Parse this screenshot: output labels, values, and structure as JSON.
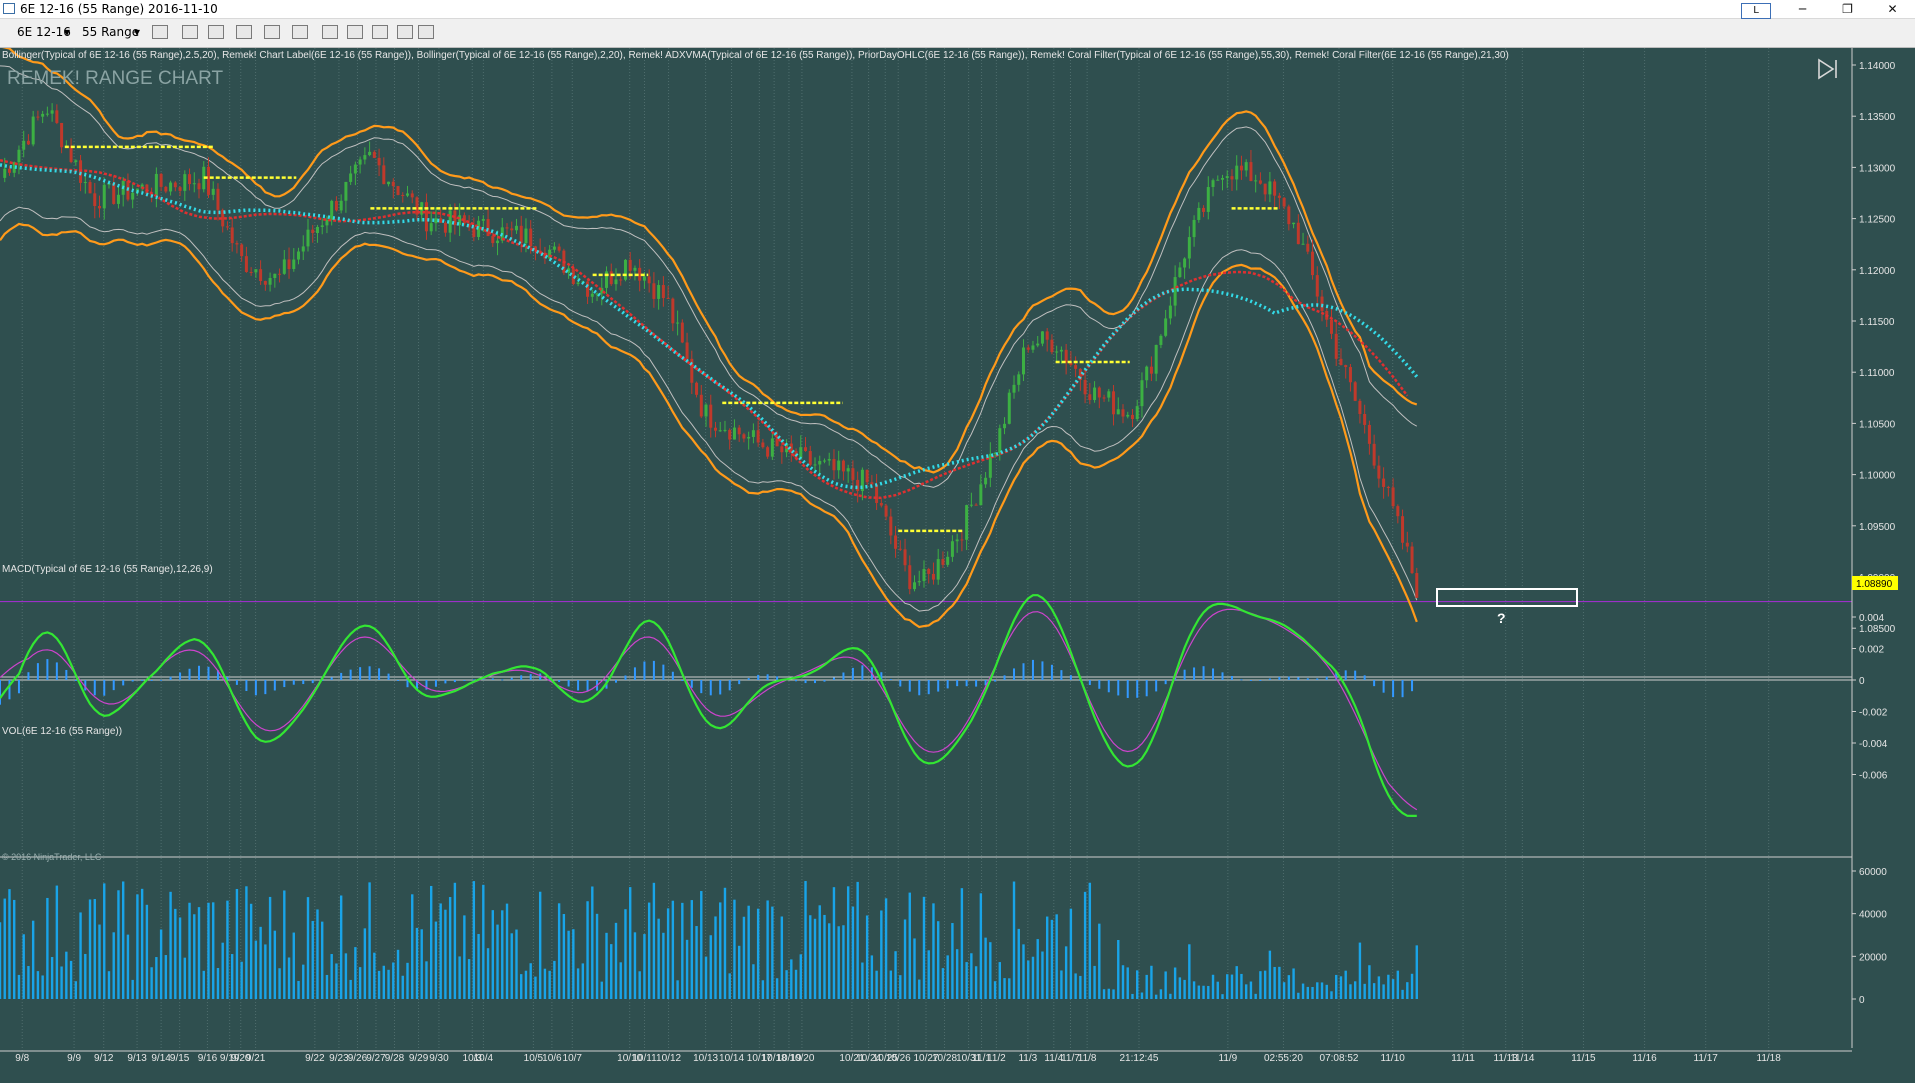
{
  "window": {
    "title": "6E 12-16 (55 Range)  2016-11-10",
    "l_button": "L",
    "minimize": "─",
    "maximize": "❐",
    "close": "✕"
  },
  "toolbar": {
    "instrument": "6E 12-16",
    "period": "55 Range"
  },
  "price_panel": {
    "indicators_label": "Bollinger(Typical of 6E 12-16 (55 Range),2.5,20), Remek! Chart Label(6E 12-16 (55 Range)), Bollinger(Typical of 6E 12-16 (55 Range),2,20), Remek! ADXVMA(Typical of 6E 12-16 (55 Range)), PriorDayOHLC(6E 12-16 (55 Range)), Remek! Coral Filter(Typical of 6E 12-16 (55 Range),55,30), Remek! Coral Filter(6E 12-16 (55 Range),21,30)",
    "watermark": "REMEK! RANGE CHART",
    "y_ticks": [
      "1.14000",
      "1.13500",
      "1.13000",
      "1.12500",
      "1.12000",
      "1.11500",
      "1.11000",
      "1.10500",
      "1.10000",
      "1.09500",
      "1.09000",
      "1.08500"
    ],
    "last_price": "1.08890",
    "question_mark": "?"
  },
  "macd_panel": {
    "label": "MACD(Typical of 6E 12-16 (55 Range),12,26,9)",
    "y_ticks": [
      "0.004",
      "0.002",
      "0",
      "-0.002",
      "-0.004",
      "-0.006"
    ]
  },
  "vol_panel": {
    "label": "VOL(6E 12-16 (55 Range))",
    "y_ticks": [
      "60000",
      "40000",
      "20000",
      "0"
    ],
    "copyright": "© 2016 NinjaTrader, LLC"
  },
  "x_axis": [
    {
      "label": "9/8",
      "anchor": 0.012
    },
    {
      "label": "9/9",
      "anchor": 0.04
    },
    {
      "label": "9/12",
      "anchor": 0.056
    },
    {
      "label": "9/13",
      "anchor": 0.074
    },
    {
      "label": "9/14",
      "anchor": 0.087
    },
    {
      "label": "9/15",
      "anchor": 0.097
    },
    {
      "label": "9/16",
      "anchor": 0.112
    },
    {
      "label": "9/19",
      "anchor": 0.124
    },
    {
      "label": "9/20",
      "anchor": 0.13
    },
    {
      "label": "9/21",
      "anchor": 0.138
    },
    {
      "label": "9/22",
      "anchor": 0.17
    },
    {
      "label": "9/23",
      "anchor": 0.183
    },
    {
      "label": "9/26",
      "anchor": 0.193
    },
    {
      "label": "9/27",
      "anchor": 0.203
    },
    {
      "label": "9/28",
      "anchor": 0.213
    },
    {
      "label": "9/29",
      "anchor": 0.226
    },
    {
      "label": "9/30",
      "anchor": 0.237
    },
    {
      "label": "10/3",
      "anchor": 0.255
    },
    {
      "label": "10/4",
      "anchor": 0.261
    },
    {
      "label": "10/5",
      "anchor": 0.288
    },
    {
      "label": "10/6",
      "anchor": 0.298
    },
    {
      "label": "10/7",
      "anchor": 0.309
    },
    {
      "label": "10/10",
      "anchor": 0.34
    },
    {
      "label": "10/11",
      "anchor": 0.348
    },
    {
      "label": "10/12",
      "anchor": 0.361
    },
    {
      "label": "10/13",
      "anchor": 0.381
    },
    {
      "label": "10/14",
      "anchor": 0.395
    },
    {
      "label": "10/17",
      "anchor": 0.41
    },
    {
      "label": "10/18",
      "anchor": 0.418
    },
    {
      "label": "10/19",
      "anchor": 0.426
    },
    {
      "label": "10/20",
      "anchor": 0.433
    },
    {
      "label": "10/21",
      "anchor": 0.46
    },
    {
      "label": "10/24",
      "anchor": 0.469
    },
    {
      "label": "10/25",
      "anchor": 0.478
    },
    {
      "label": "10/26",
      "anchor": 0.485
    },
    {
      "label": "10/27",
      "anchor": 0.5
    },
    {
      "label": "10/28",
      "anchor": 0.51
    },
    {
      "label": "10/31",
      "anchor": 0.523
    },
    {
      "label": "11/1",
      "anchor": 0.53
    },
    {
      "label": "11/2",
      "anchor": 0.538
    },
    {
      "label": "11/3",
      "anchor": 0.555
    },
    {
      "label": "11/4",
      "anchor": 0.569
    },
    {
      "label": "11/7",
      "anchor": 0.578
    },
    {
      "label": "11/8",
      "anchor": 0.587
    },
    {
      "label": "21:12:45",
      "anchor": 0.615
    },
    {
      "label": "11/9",
      "anchor": 0.663
    },
    {
      "label": "02:55:20",
      "anchor": 0.693
    },
    {
      "label": "07:08:52",
      "anchor": 0.723
    },
    {
      "label": "11/10",
      "anchor": 0.752
    },
    {
      "label": "11/11",
      "anchor": 0.79
    },
    {
      "label": "11/13",
      "anchor": 0.813
    },
    {
      "label": "11/14",
      "anchor": 0.822
    },
    {
      "label": "11/15",
      "anchor": 0.855
    },
    {
      "label": "11/16",
      "anchor": 0.888
    },
    {
      "label": "11/17",
      "anchor": 0.921
    },
    {
      "label": "11/18",
      "anchor": 0.955
    }
  ],
  "colors": {
    "background": "#2f4f4f",
    "bb_outer": "#ff9a1a",
    "bb_inner": "#bfbfbf",
    "adxvma_up": "#ffff33",
    "adxvma_down": "#e03030",
    "coral": "#33dbe8",
    "macd": "#33e633",
    "signal": "#cc44cc",
    "hist": "#3399ff",
    "volume": "#19a4e8",
    "prior_day": "#9b30c8"
  }
}
